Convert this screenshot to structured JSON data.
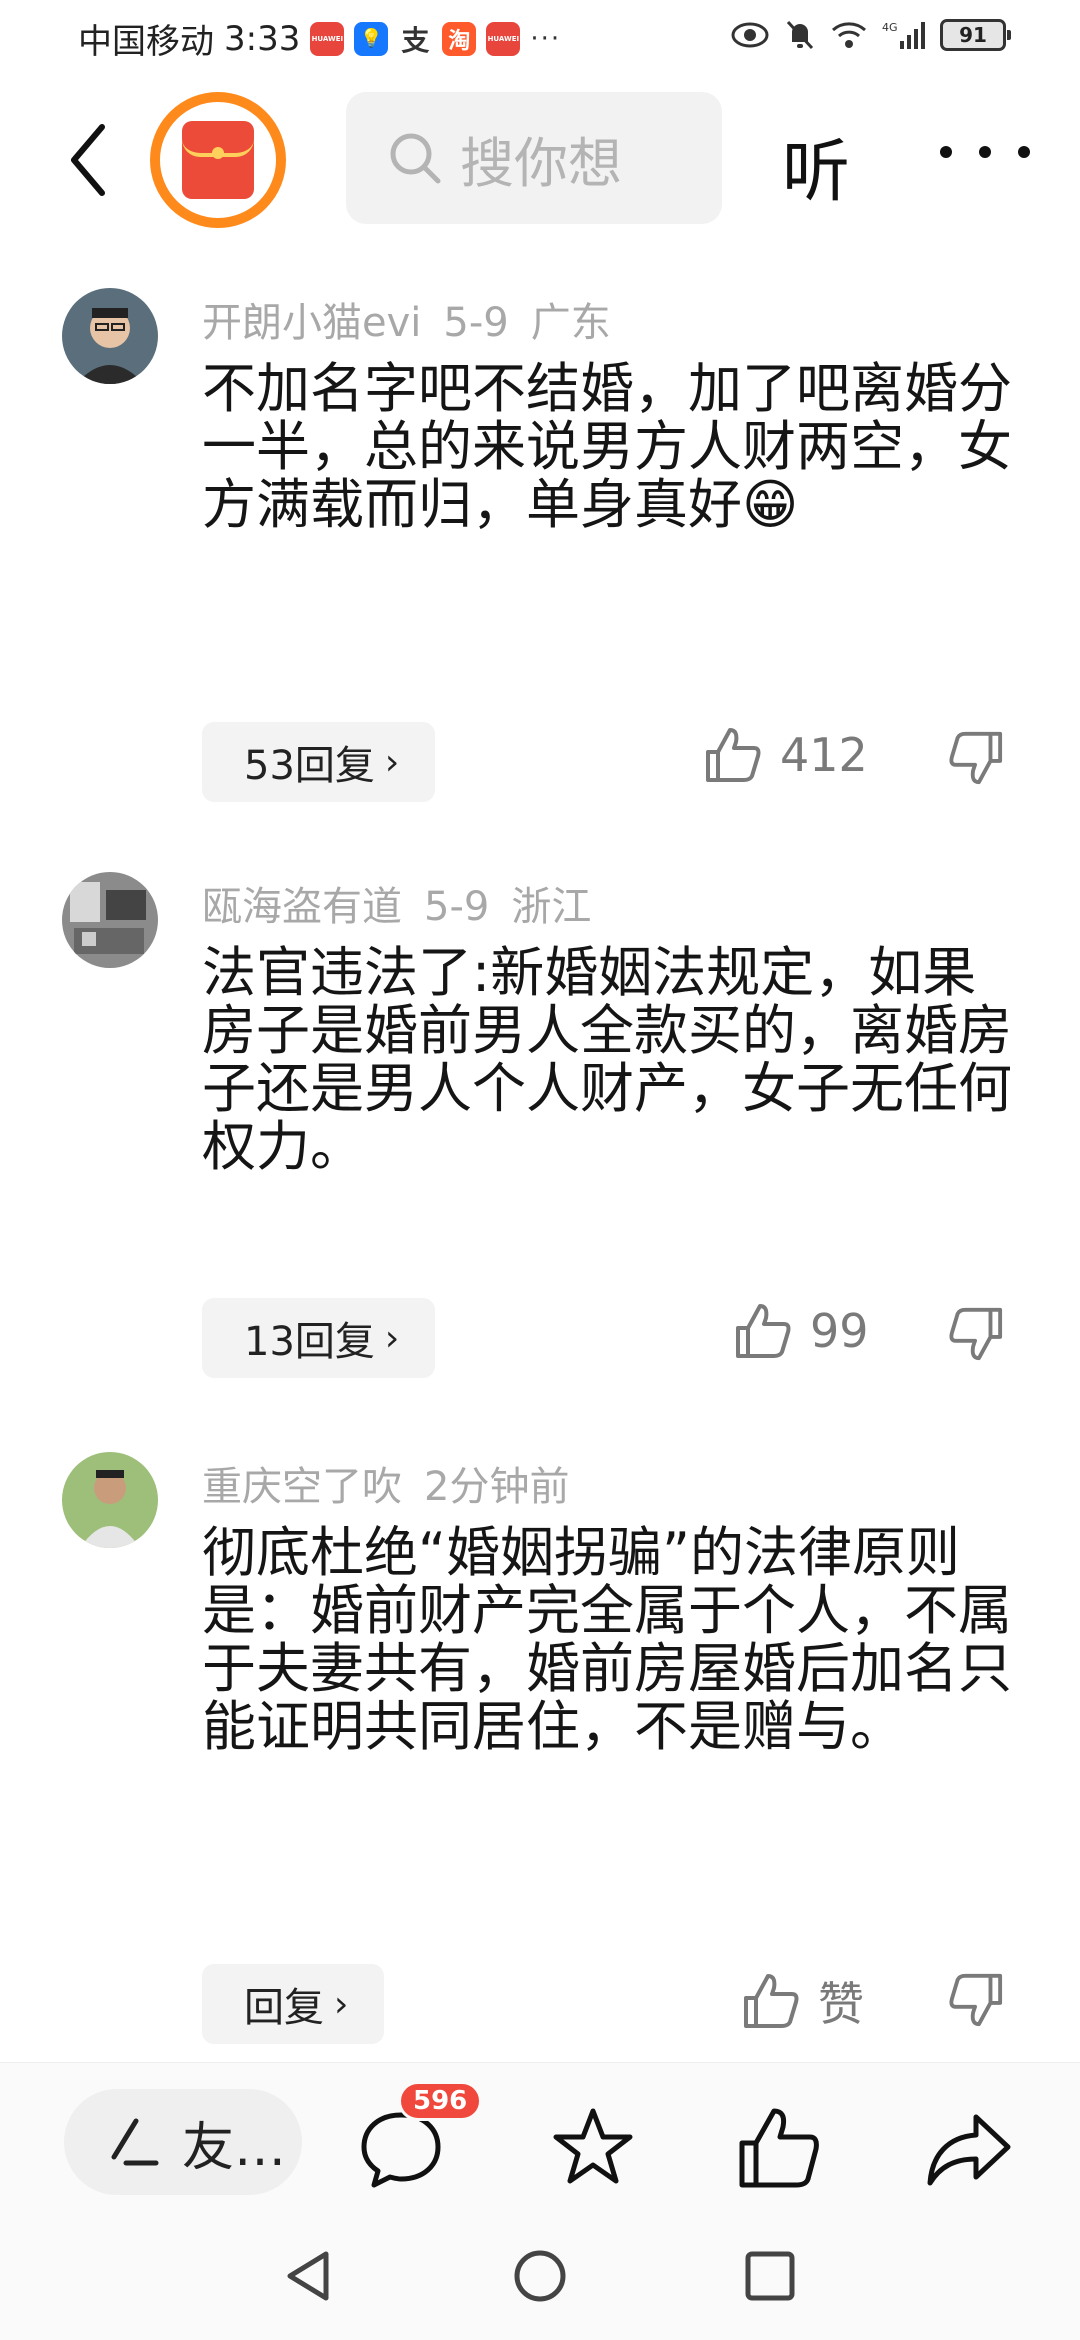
{
  "status_bar": {
    "carrier": "中国移动",
    "time": "3:33",
    "app_icons": [
      "HUAWEI",
      "💡",
      "支",
      "淘",
      "HUAWEI"
    ],
    "more": "···",
    "battery": "91",
    "network": "4G"
  },
  "top_nav": {
    "search_placeholder": "搜你想",
    "listen_label": "听"
  },
  "comments": [
    {
      "username": "开朗小猫evi",
      "date": "5-9",
      "location": "广东",
      "text": "不加名字吧不结婚，加了吧离婚分一半，总的来说男方人财两空，女方满载而归，单身真好😁",
      "reply_label": "53回复",
      "likes": "412"
    },
    {
      "username": "瓯海盗有道",
      "date": "5-9",
      "location": "浙江",
      "text": "法官违法了:新婚姻法规定，如果房子是婚前男人全款买的，离婚房子还是男人个人财产，女子无任何权力。",
      "reply_label": "13回复",
      "likes": "99"
    },
    {
      "username": "重庆空了吹",
      "date": "2分钟前",
      "location": "",
      "text": "彻底杜绝“婚姻拐骗”的法律原则是：婚前财产完全属于个人，不属于夫妻共有，婚前房屋婚后加名只能证明共同居住，不是赠与。",
      "reply_label": "回复",
      "likes": "赞"
    }
  ],
  "action_bar": {
    "write_label": "友…",
    "comment_count": "596"
  },
  "colors": {
    "accent_orange": "#ff8a1c",
    "red": "#ec4b39",
    "badge": "#f0483c",
    "meta_gray": "#a8a8a8"
  }
}
